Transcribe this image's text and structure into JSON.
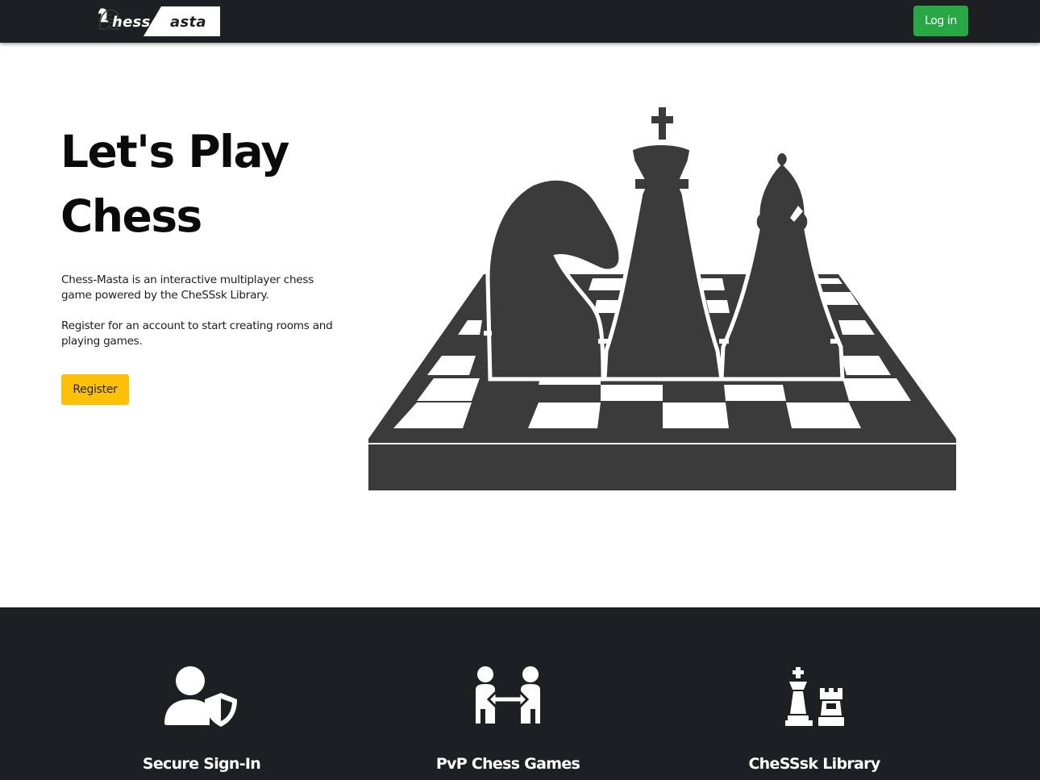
{
  "navbar": {
    "brand": {
      "part1": "hess",
      "part2": "asta"
    },
    "login_label": "Log in",
    "login_color": "#28a745"
  },
  "hero": {
    "title_line1": "Let's Play",
    "title_line2": "Chess",
    "paragraph1": "Chess-Masta is an interactive multiplayer chess game powered by the CheSSsk Library.",
    "paragraph2": "Register for an account to start creating rooms and playing games.",
    "register_label": "Register",
    "register_color": "#ffc107",
    "illustration_icon": "chess-pieces-board-icon"
  },
  "features": [
    {
      "icon": "user-shield-icon",
      "title": "Secure Sign-In"
    },
    {
      "icon": "people-arrows-icon",
      "title": "PvP Chess Games"
    },
    {
      "icon": "chess-king-rook-icon",
      "title": "CheSSsk Library"
    }
  ],
  "colors": {
    "dark": "#1e1f22",
    "illustration": "#3b3b3b"
  }
}
